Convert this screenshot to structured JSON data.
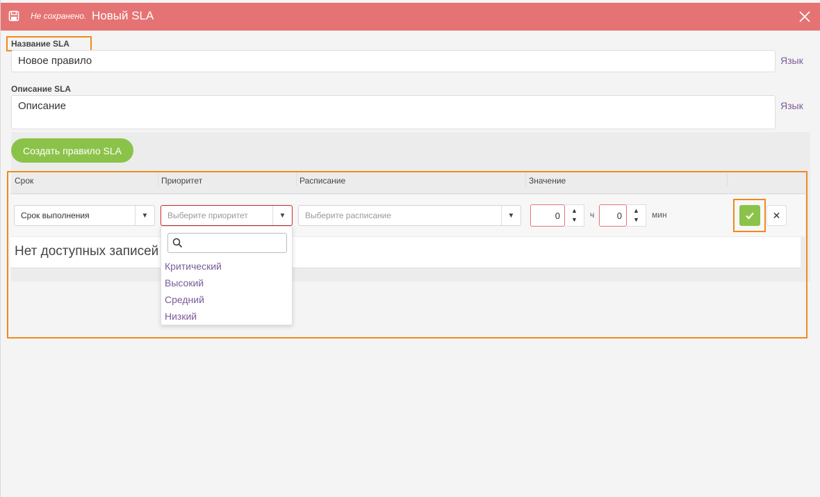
{
  "header": {
    "unsaved_label": "Не сохранено.",
    "title": "Новый SLA",
    "save_icon": "save-icon",
    "close_icon": "close-icon"
  },
  "form": {
    "name_label": "Название SLA",
    "name_value": "Новое правило",
    "description_label": "Описание SLA",
    "description_value": "Описание",
    "language_link": "Язык",
    "create_button": "Создать правило SLA"
  },
  "table": {
    "columns": [
      "Срок",
      "Приоритет",
      "Расписание",
      "Значение"
    ],
    "row": {
      "term_value": "Срок выполнения",
      "priority_placeholder": "Выберите приоритет",
      "schedule_placeholder": "Выберите расписание",
      "hours_value": "0",
      "hours_unit": "ч",
      "minutes_value": "0",
      "minutes_unit": "мин"
    },
    "empty_text": "Нет доступных записей"
  },
  "priority_dropdown": {
    "search_value": "",
    "options": [
      "Критический",
      "Высокий",
      "Средний",
      "Низкий"
    ]
  },
  "colors": {
    "header_bg": "#e57373",
    "accent_green": "#8bc34a",
    "link_purple": "#7b5a9a",
    "highlight_orange": "#f08a1c"
  }
}
